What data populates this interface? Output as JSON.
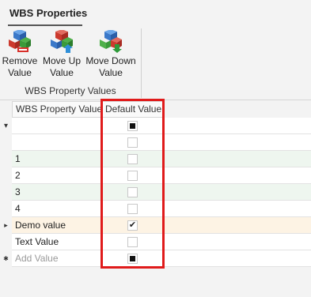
{
  "tab": {
    "title": "WBS Properties"
  },
  "ribbon": {
    "buttons": [
      {
        "line1": "Remove",
        "line2": "Value",
        "icon": "cube-remove-icon"
      },
      {
        "line1": "Move Up",
        "line2": "Value",
        "icon": "cube-move-up-icon"
      },
      {
        "line1": "Move Down",
        "line2": "Value",
        "icon": "cube-move-down-icon"
      }
    ],
    "group_label": "WBS Property Values"
  },
  "grid": {
    "columns": [
      "WBS Property Value",
      "Default Value"
    ],
    "rows": [
      {
        "indicator": "filter",
        "value": "",
        "default": "indeterminate",
        "bg": "#ffffff"
      },
      {
        "indicator": "",
        "value": "",
        "default": "unchecked",
        "bg": "#ffffff"
      },
      {
        "indicator": "",
        "value": "1",
        "default": "unchecked",
        "bg": "#eef6ef"
      },
      {
        "indicator": "",
        "value": "2",
        "default": "unchecked",
        "bg": "#ffffff"
      },
      {
        "indicator": "",
        "value": "3",
        "default": "unchecked",
        "bg": "#eef6ef"
      },
      {
        "indicator": "",
        "value": "4",
        "default": "unchecked",
        "bg": "#ffffff"
      },
      {
        "indicator": "current",
        "value": "Demo value",
        "default": "checked",
        "bg": "#fdf3e4"
      },
      {
        "indicator": "",
        "value": "Text Value",
        "default": "unchecked",
        "bg": "#ffffff"
      },
      {
        "indicator": "new",
        "value": "Add Value",
        "default": "indeterminate",
        "bg": "#ffffff",
        "placeholder": true
      }
    ]
  },
  "colors": {
    "highlight": "#e01b1b",
    "alt_row": "#eef6ef",
    "current_row": "#fdf3e4"
  }
}
